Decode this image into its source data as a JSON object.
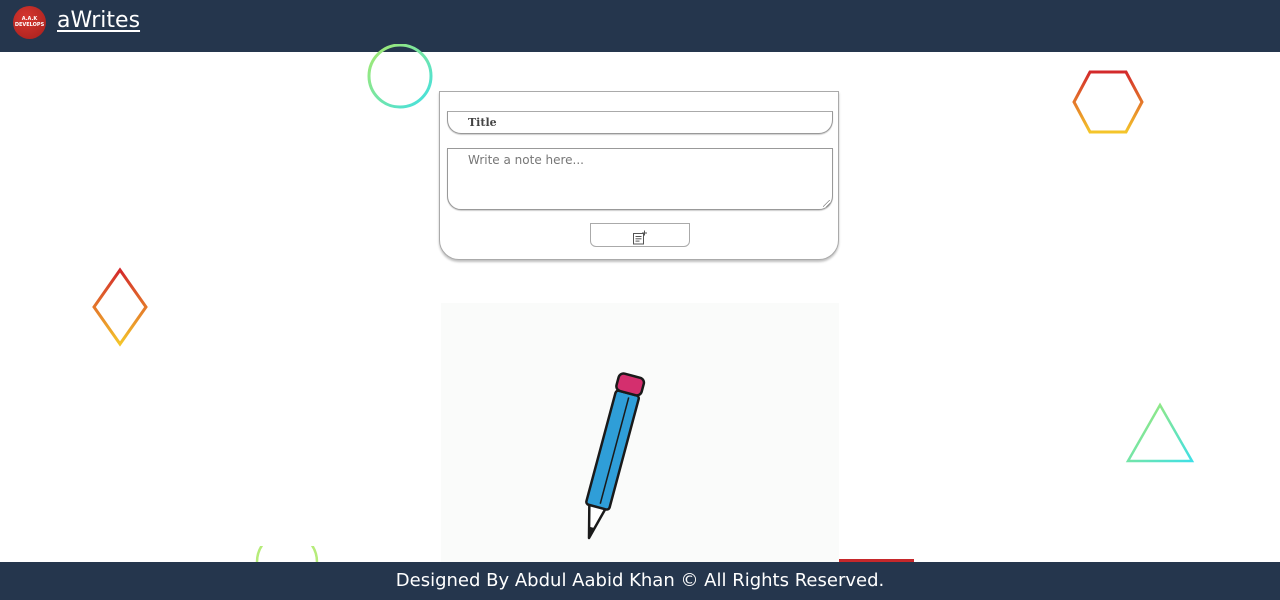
{
  "header": {
    "brand": "aWrites",
    "logo_text_line1": "A.A.K",
    "logo_text_line2": "DEVELOPS"
  },
  "form": {
    "title_placeholder": "Title",
    "note_placeholder": "Write a note here...",
    "add_button_icon": "note-add-icon"
  },
  "footer": {
    "text": "Designed By Abdul Aabid Khan © All Rights Reserved."
  },
  "colors": {
    "header_bg": "#25364d",
    "accent_red": "#c6282b",
    "pencil_body": "#2f9ed8",
    "pencil_eraser": "#d42f6e"
  },
  "decorations": [
    "circle-shape",
    "hexagon-shape",
    "diamond-shape",
    "triangle-shape",
    "circle-shape-bottom"
  ]
}
